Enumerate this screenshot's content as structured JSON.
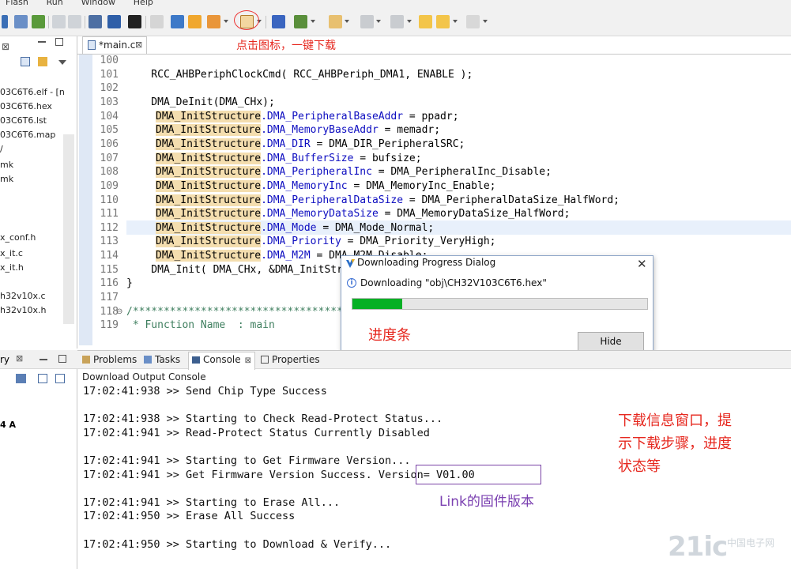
{
  "menu": [
    "Flash",
    "Run",
    "Window",
    "Help"
  ],
  "annotations": {
    "toolbar_note": "点击图标，一键下载",
    "progress_note": "进度条",
    "info_note_lines": [
      "下载信息窗口，提",
      "示下载步骤，进度",
      "状态等"
    ],
    "link_note": "Link的固件版本"
  },
  "explorer": {
    "items": [
      "03C6T6.elf - [n",
      "03C6T6.hex",
      "03C6T6.lst",
      "03C6T6.map",
      "/",
      "mk",
      "mk",
      "x_conf.h",
      "x_it.c",
      "x_it.h",
      "h32v10x.c",
      "h32v10x.h"
    ],
    "bottom_tab": "ry",
    "bottom_fragment": "4 A"
  },
  "editor": {
    "tab_label": "*main.c",
    "lines": [
      {
        "n": "100",
        "code": ""
      },
      {
        "n": "101",
        "code": "    RCC_AHBPeriphClockCmd( RCC_AHBPeriph_DMA1, ENABLE );"
      },
      {
        "n": "102",
        "code": ""
      },
      {
        "n": "103",
        "code": "    DMA_DeInit(DMA_CHx);"
      },
      {
        "n": "104",
        "hl": "DMA_InitStructure",
        "field": ".DMA_PeripheralBaseAddr",
        "rest": " = ppadr;"
      },
      {
        "n": "105",
        "hl": "DMA_InitStructure",
        "field": ".DMA_MemoryBaseAddr",
        "rest": " = memadr;"
      },
      {
        "n": "106",
        "hl": "DMA_InitStructure",
        "field": ".DMA_DIR",
        "rest": " = DMA_DIR_PeripheralSRC;"
      },
      {
        "n": "107",
        "hl": "DMA_InitStructure",
        "field": ".DMA_BufferSize",
        "rest": " = bufsize;"
      },
      {
        "n": "108",
        "hl": "DMA_InitStructure",
        "field": ".DMA_PeripheralInc",
        "rest": " = DMA_PeripheralInc_Disable;"
      },
      {
        "n": "109",
        "hl": "DMA_InitStructure",
        "field": ".DMA_MemoryInc",
        "rest": " = DMA_MemoryInc_Enable;"
      },
      {
        "n": "110",
        "hl": "DMA_InitStructure",
        "field": ".DMA_PeripheralDataSize",
        "rest": " = DMA_PeripheralDataSize_HalfWord;"
      },
      {
        "n": "111",
        "hl": "DMA_InitStructure",
        "field": ".DMA_MemoryDataSize",
        "rest": " = DMA_MemoryDataSize_HalfWord;"
      },
      {
        "n": "112",
        "hl": "DMA_InitStructure",
        "field": ".DMA_Mode",
        "rest": " = DMA_Mode_Normal;"
      },
      {
        "n": "113",
        "hl": "DMA_InitStructure",
        "field": ".DMA_Priority",
        "rest": " = DMA_Priority_VeryHigh;"
      },
      {
        "n": "114",
        "hl": "DMA_InitStructure",
        "field": ".DMA_M2M",
        "rest": " = DMA_M2M_Disable;"
      },
      {
        "n": "115",
        "code": "    DMA_Init( DMA_CHx, &DMA_InitStructure );"
      },
      {
        "n": "116",
        "code": "}"
      },
      {
        "n": "117",
        "code": ""
      },
      {
        "n": "118",
        "code": "/*******************************************************************************"
      },
      {
        "n": "119",
        "code": " * Function Name  : main"
      }
    ]
  },
  "bottom_tabs": [
    "Problems",
    "Tasks",
    "Console",
    "Properties"
  ],
  "console": {
    "header": "Download Output Console",
    "lines": [
      "17:02:41:938 >> Send Chip Type Success",
      "",
      "17:02:41:938 >> Starting to Check Read-Protect Status...",
      "17:02:41:941 >> Read-Protect Status Currently Disabled",
      "",
      "17:02:41:941 >> Starting to Get Firmware Version...",
      "17:02:41:941 >> Get Firmware Version Success. Version= V01.00",
      "",
      "17:02:41:941 >> Starting to Erase All...",
      "17:02:41:950 >> Erase All Success",
      "",
      "17:02:41:950 >> Starting to Download & Verify..."
    ]
  },
  "dialog": {
    "title": "Downloading Progress Dialog",
    "message": "Downloading \"obj\\CH32V103C6T6.hex\"",
    "progress": 0.17,
    "hide_label": "Hide",
    "close_glyph": "✕"
  },
  "watermark": "21ic",
  "watermark_sub": "中国电子网",
  "colors": {
    "annotation_red": "#e6281f",
    "progress_green": "#06b025",
    "link_purple": "#7a3fb0"
  }
}
